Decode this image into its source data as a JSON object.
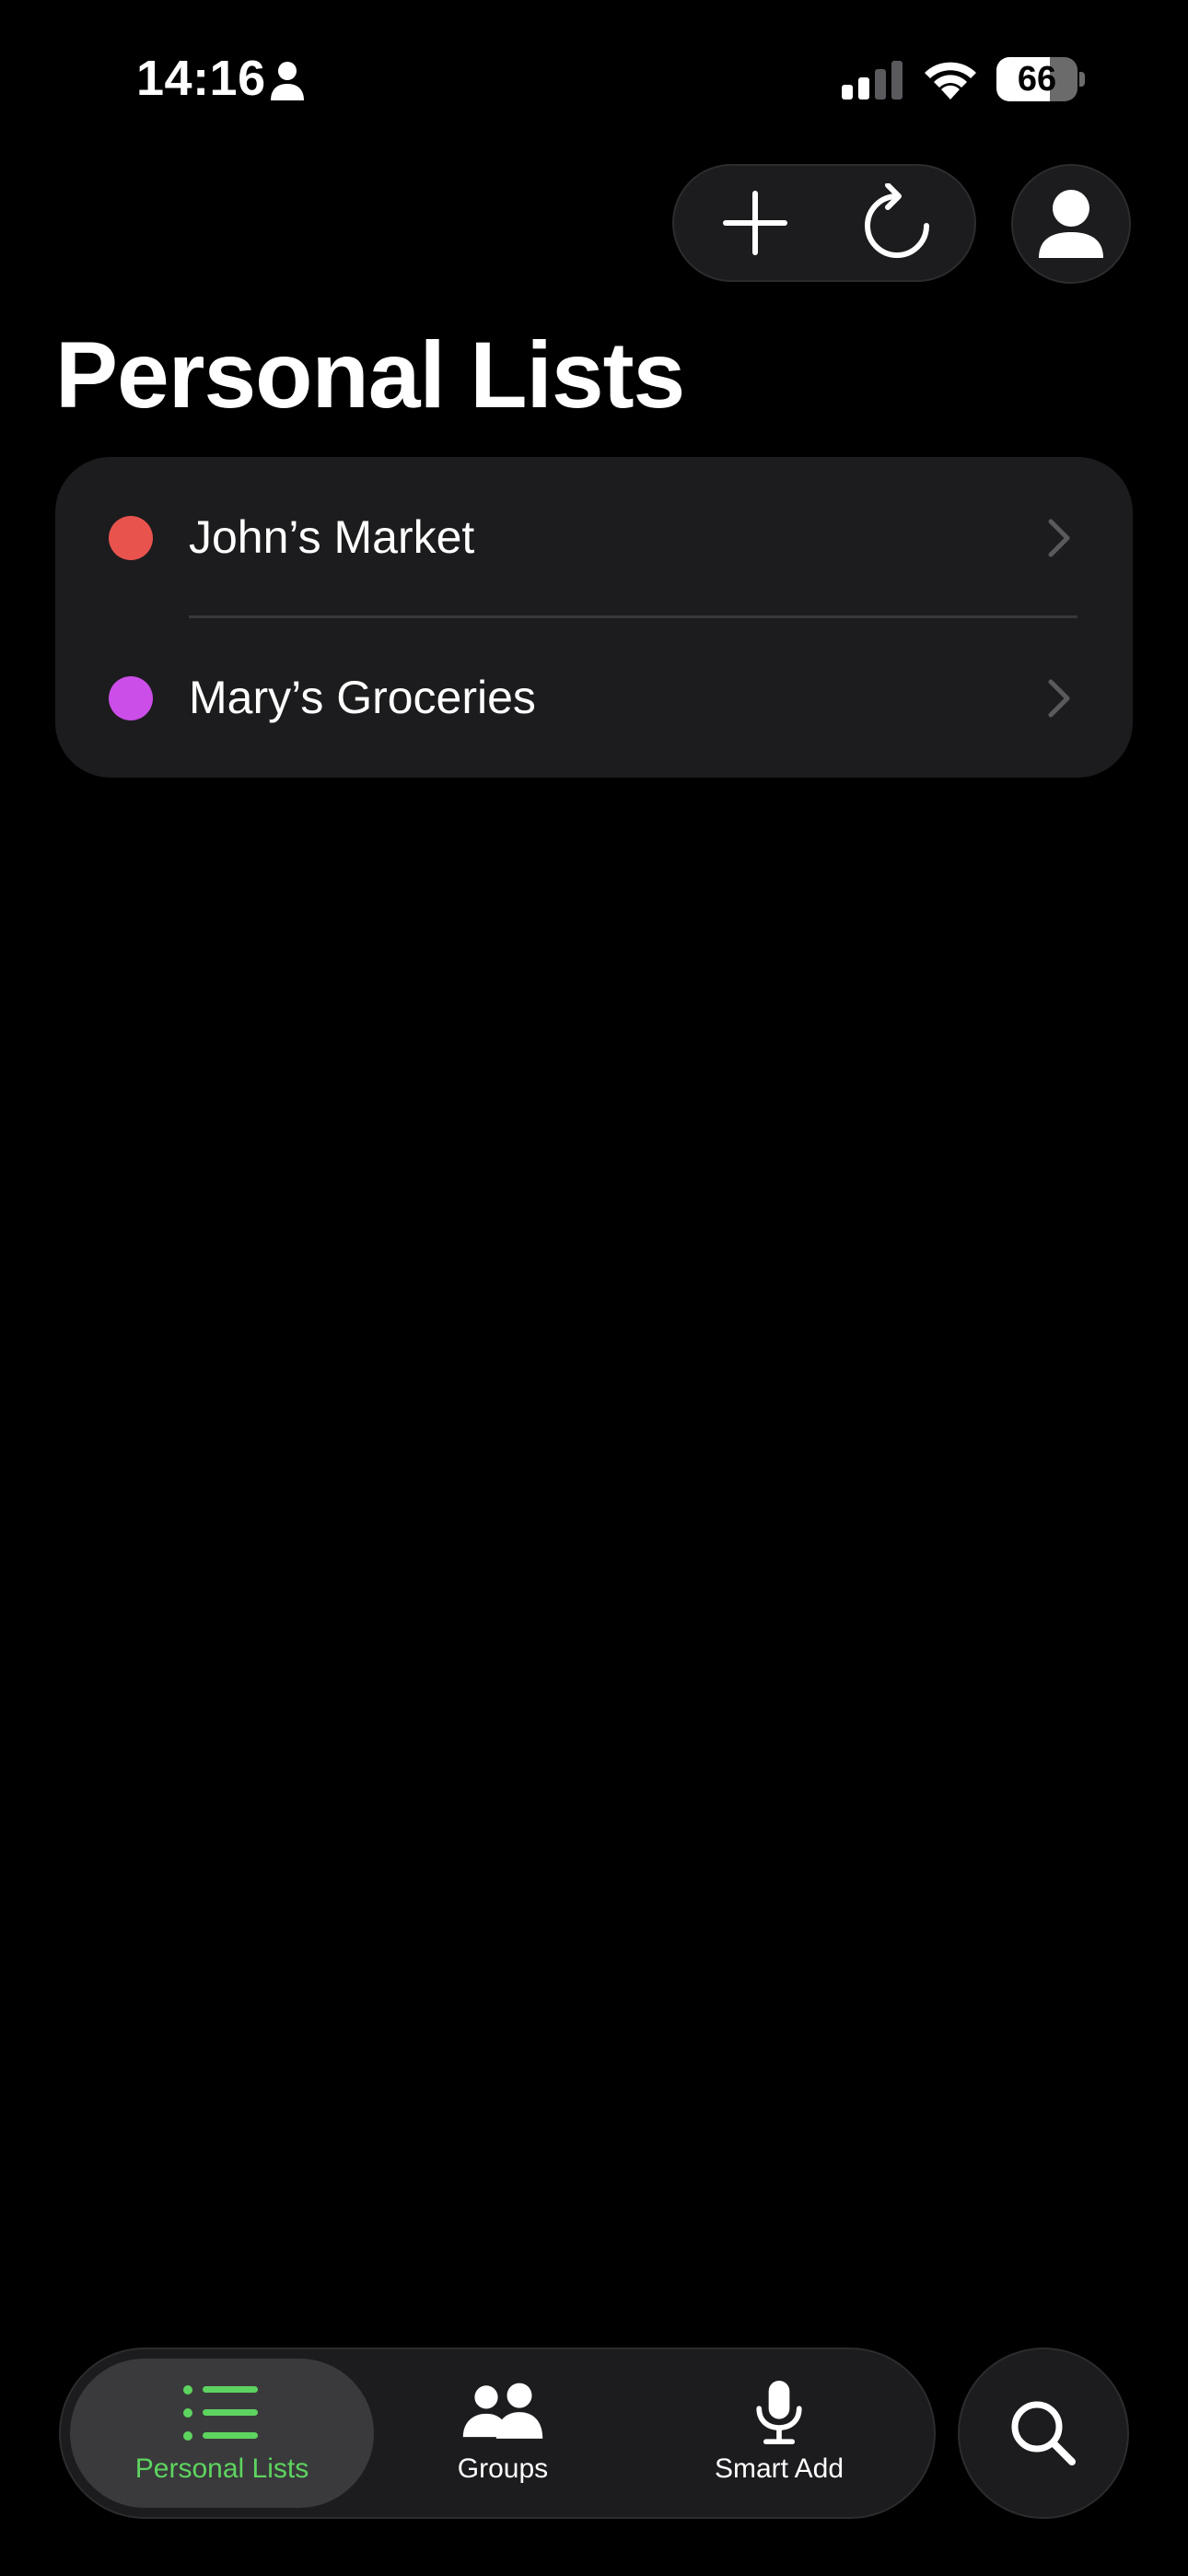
{
  "status_bar": {
    "time": "14:16",
    "battery_level": "66",
    "icons": [
      "person-icon",
      "cellular-signal-icon",
      "wifi-icon",
      "battery-icon"
    ]
  },
  "toolbar": {
    "icons": [
      "plus-icon",
      "refresh-icon",
      "profile-icon"
    ]
  },
  "page": {
    "title": "Personal Lists"
  },
  "lists": [
    {
      "label": "John’s Market",
      "color": "#e9534e"
    },
    {
      "label": "Mary’s Groceries",
      "color": "#cc4ee8"
    }
  ],
  "tab_bar": {
    "tabs": [
      {
        "label": "Personal Lists",
        "icon": "list-icon",
        "active": true
      },
      {
        "label": "Groups",
        "icon": "people-icon",
        "active": false
      },
      {
        "label": "Smart Add",
        "icon": "microphone-icon",
        "active": false
      }
    ],
    "search_icon": "search-icon"
  },
  "colors": {
    "background": "#000000",
    "card": "#1c1c1e",
    "accent_green": "#5dd45f",
    "chevron": "#5a5a5e"
  }
}
